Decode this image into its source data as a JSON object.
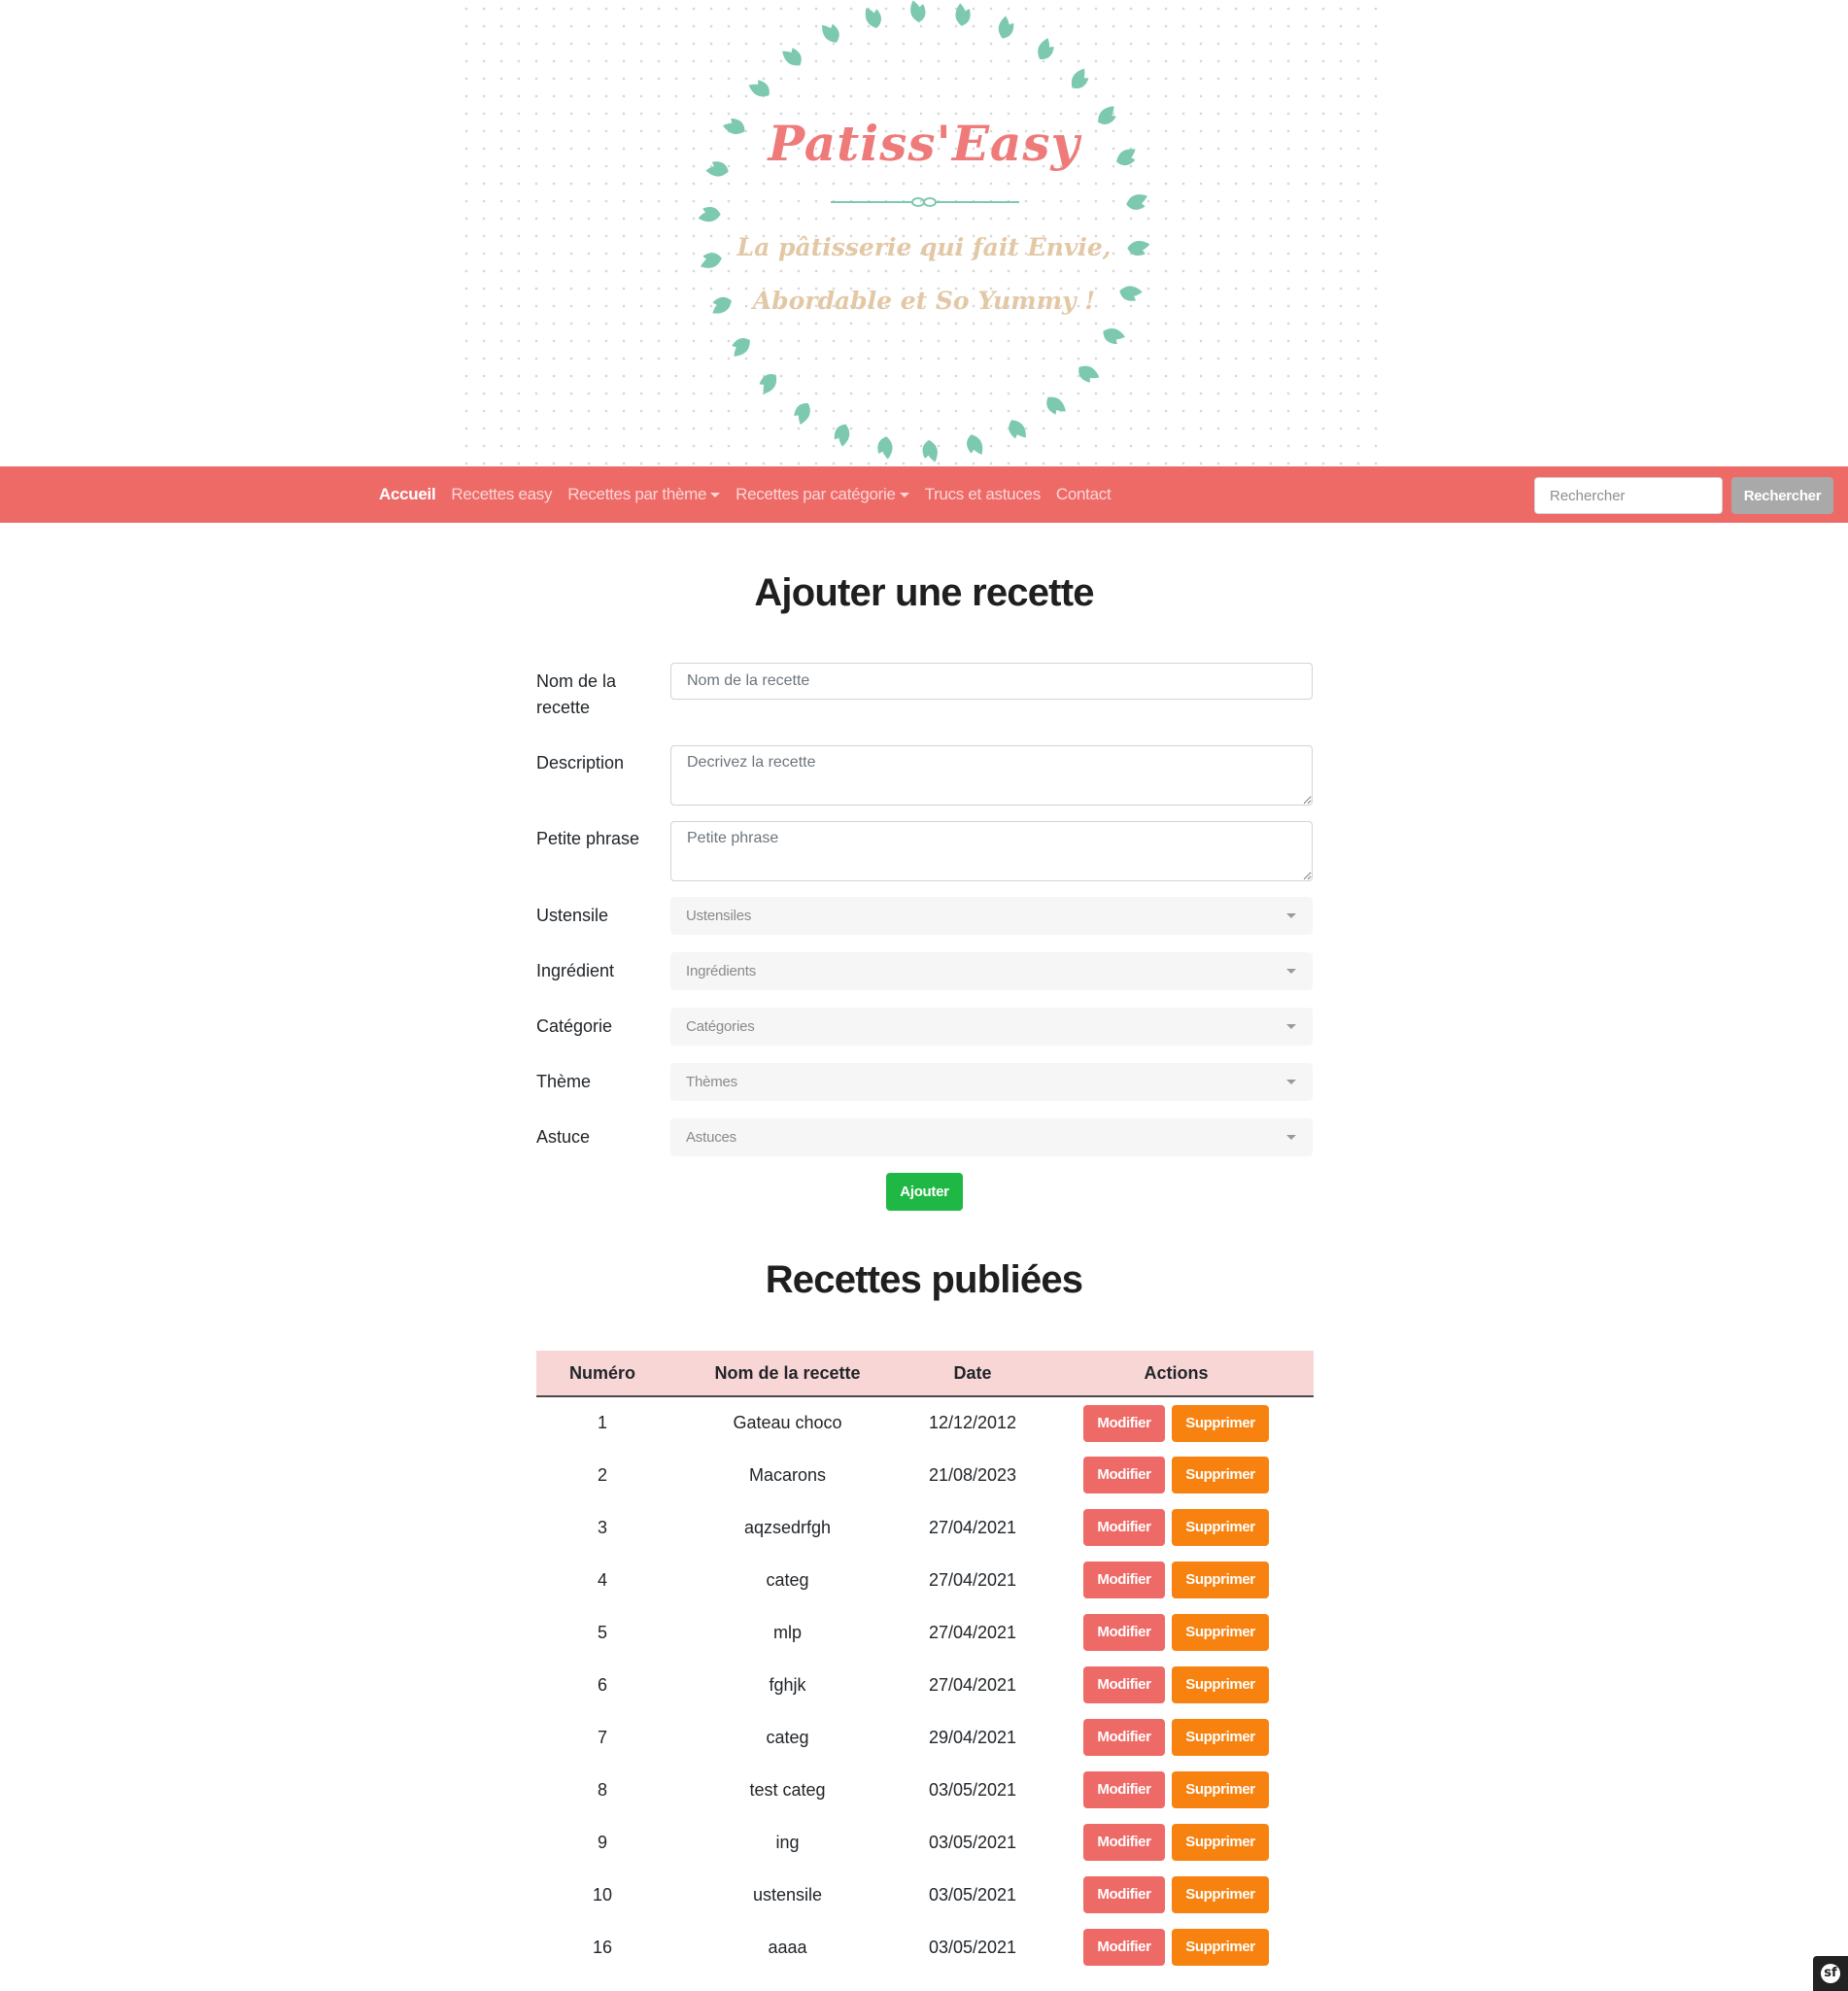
{
  "banner": {
    "title": "Patiss'Easy",
    "tagline_1": "La pâtisserie qui fait Envie,",
    "tagline_2": "Abordable et So Yummy !"
  },
  "nav": {
    "items": [
      {
        "label": "Accueil",
        "active": true,
        "dropdown": false
      },
      {
        "label": "Recettes easy",
        "active": false,
        "dropdown": false
      },
      {
        "label": "Recettes par thème",
        "active": false,
        "dropdown": true
      },
      {
        "label": "Recettes par catégorie",
        "active": false,
        "dropdown": true
      },
      {
        "label": "Trucs et astuces",
        "active": false,
        "dropdown": false
      },
      {
        "label": "Contact",
        "active": false,
        "dropdown": false
      }
    ],
    "search_placeholder": "Rechercher",
    "search_button": "Rechercher"
  },
  "form": {
    "title": "Ajouter une recette",
    "fields": {
      "nom": {
        "label": "Nom de la recette",
        "placeholder": "Nom de la recette",
        "value": ""
      },
      "description": {
        "label": "Description",
        "placeholder": "Decrivez la recette",
        "value": ""
      },
      "phrase": {
        "label": "Petite phrase",
        "placeholder": "Petite phrase",
        "value": ""
      },
      "ustensile": {
        "label": "Ustensile",
        "selected": "Ustensiles"
      },
      "ingredient": {
        "label": "Ingrédient",
        "selected": "Ingrédients"
      },
      "categorie": {
        "label": "Catégorie",
        "selected": "Catégories"
      },
      "theme": {
        "label": "Thème",
        "selected": "Thèmes"
      },
      "astuce": {
        "label": "Astuce",
        "selected": "Astuces"
      }
    },
    "submit": "Ajouter"
  },
  "published": {
    "title": "Recettes publiées",
    "columns": [
      "Numéro",
      "Nom de la recette",
      "Date",
      "Actions"
    ],
    "edit_label": "Modifier",
    "delete_label": "Supprimer",
    "rows": [
      {
        "num": "1",
        "name": "Gateau choco",
        "date": "12/12/2012"
      },
      {
        "num": "2",
        "name": "Macarons",
        "date": "21/08/2023"
      },
      {
        "num": "3",
        "name": "aqzsedrfgh",
        "date": "27/04/2021"
      },
      {
        "num": "4",
        "name": "categ",
        "date": "27/04/2021"
      },
      {
        "num": "5",
        "name": "mlp",
        "date": "27/04/2021"
      },
      {
        "num": "6",
        "name": "fghjk",
        "date": "27/04/2021"
      },
      {
        "num": "7",
        "name": "categ",
        "date": "29/04/2021"
      },
      {
        "num": "8",
        "name": "test categ",
        "date": "03/05/2021"
      },
      {
        "num": "9",
        "name": "ing",
        "date": "03/05/2021"
      },
      {
        "num": "10",
        "name": "ustensile",
        "date": "03/05/2021"
      },
      {
        "num": "16",
        "name": "aaaa",
        "date": "03/05/2021"
      }
    ]
  },
  "colors": {
    "navbar": "#ee6a67",
    "title_pink": "#ee7a7a",
    "leaf_green": "#7cc9af",
    "add_green": "#20b845",
    "modify_red": "#ee6a67",
    "delete_orange": "#f7820f",
    "table_header": "#f9d6d6"
  },
  "icons": {
    "debug_toolbar": "symfony-icon",
    "select_caret": "chevron-down-icon"
  }
}
